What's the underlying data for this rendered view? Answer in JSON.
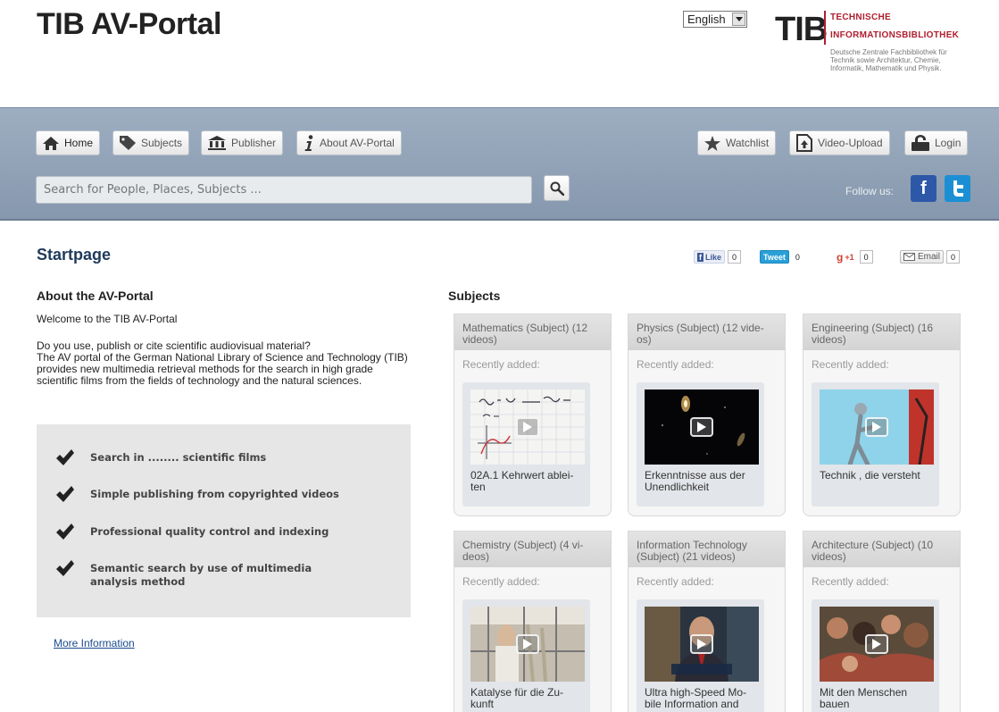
{
  "header": {
    "site_title": "TIB AV-Portal",
    "language": "English",
    "logo": {
      "abbr": "TIB",
      "name_line1": "Technische",
      "name_line2": "Informationsbibliothek",
      "subtitle": "Deutsche Zentrale Fachbibliothek für Technik sowie Architektur, Chemie, Informatik, Mathematik und Physik."
    }
  },
  "nav": {
    "left": [
      {
        "label": "Home",
        "icon": "home-icon"
      },
      {
        "label": "Subjects",
        "icon": "tag-icon"
      },
      {
        "label": "Publisher",
        "icon": "building-icon"
      },
      {
        "label": "About AV-Portal",
        "icon": "info-icon"
      }
    ],
    "right": [
      {
        "label": "Watchlist",
        "icon": "star-icon"
      },
      {
        "label": "Video-Upload",
        "icon": "upload-icon"
      },
      {
        "label": "Login",
        "icon": "lock-icon"
      }
    ],
    "search_placeholder": "Search for People, Places, Subjects ...",
    "follow_label": "Follow us:",
    "colors": {
      "band": "#8fa0b6",
      "facebook": "#2d58a8",
      "twitter": "#1c8fd4"
    }
  },
  "page": {
    "title": "Startpage",
    "share": {
      "like_label": "Like",
      "like_count": "0",
      "tweet_label": "Tweet",
      "tweet_count": "0",
      "gplus_label": "+1",
      "gplus_count": "0",
      "email_label": "Email",
      "email_count": "0"
    }
  },
  "about": {
    "heading": "About the AV-Portal",
    "welcome": "Welcome to the TIB AV-Portal",
    "intro_question": "Do you use, publish or cite scientific audiovisual material?",
    "intro_text": "The AV portal of the German National Library of Science and Technology (TIB) provides new multimedia retrieval methods for the search in high grade scientific films from the fields of technology and the natural sciences.",
    "features": [
      "Search in ........ scientific films",
      "Simple publishing from copyrighted videos",
      "Professional quality control and indexing",
      "Semantic search by use of multimedia analysis method"
    ],
    "more_info": "More Information"
  },
  "subjects": {
    "heading": "Subjects",
    "recently_added_label": "Recently added:",
    "cards": [
      {
        "title": "Mathematics (Subject) (12 videos)",
        "video_title": "02A.1 Kehrwert ablei-ten",
        "thumb": "math-whiteboard"
      },
      {
        "title": "Physics (Subject) (12 vide-os)",
        "video_title": "Erkenntnisse aus der Unendlichkeit",
        "thumb": "galaxy"
      },
      {
        "title": "Engineering (Subject) (16 videos)",
        "video_title": "Technik , die versteht",
        "thumb": "robot"
      },
      {
        "title": "Chemistry (Subject) (4 vi-deos)",
        "video_title": "Katalyse für die Zu-kunft",
        "thumb": "lab"
      },
      {
        "title": "Information Technology (Subject) (21 videos)",
        "video_title": "Ultra high-Speed Mo-bile Information and",
        "thumb": "interview"
      },
      {
        "title": "Architecture (Subject) (10 videos)",
        "video_title": "Mit den Menschen bauen",
        "thumb": "crowd"
      }
    ]
  }
}
